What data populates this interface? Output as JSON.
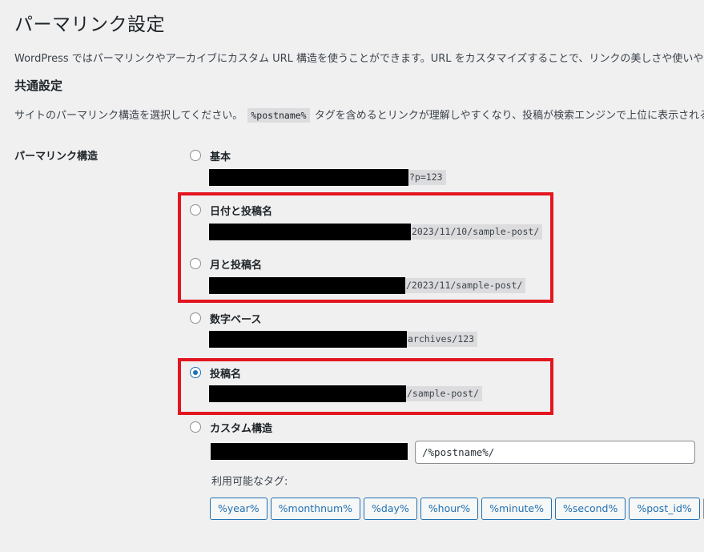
{
  "page": {
    "title": "パーマリンク設定",
    "intro": "WordPress ではパーマリンクやアーカイブにカスタム URL 構造を使うことができます。URL をカスタマイズすることで、リンクの美しさや使いやす"
  },
  "common": {
    "title": "共通設定",
    "desc_before": "サイトのパーマリンク構造を選択してください。",
    "desc_code": "%postname%",
    "desc_after": "タグを含めるとリンクが理解しやすくなり、投稿が検索エンジンで上位に表示される"
  },
  "structure": {
    "label": "パーマリンク構造",
    "options": [
      {
        "label": "基本",
        "suffix": "?p=123",
        "checked": false
      },
      {
        "label": "日付と投稿名",
        "suffix": "2023/11/10/sample-post/",
        "checked": false
      },
      {
        "label": "月と投稿名",
        "suffix": "/2023/11/sample-post/",
        "checked": false
      },
      {
        "label": "数字ベース",
        "suffix": "archives/123",
        "checked": false
      },
      {
        "label": "投稿名",
        "suffix": "/sample-post/",
        "checked": true
      },
      {
        "label": "カスタム構造",
        "checked": false
      }
    ],
    "custom_value": "/%postname%/",
    "tags_label": "利用可能なタグ:",
    "tags": [
      "%year%",
      "%monthnum%",
      "%day%",
      "%hour%",
      "%minute%",
      "%second%",
      "%post_id%",
      "%"
    ]
  },
  "colors": {
    "highlight": "#e3161f",
    "accent": "#2271b1",
    "background": "#f0f0f1"
  }
}
